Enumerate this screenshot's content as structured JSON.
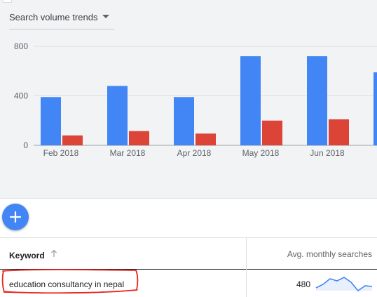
{
  "selector": {
    "label": "Search volume trends",
    "icon": "dropdown-caret-icon"
  },
  "chart_data": {
    "type": "bar",
    "categories": [
      "Feb 2018",
      "Mar 2018",
      "Apr 2018",
      "May 2018",
      "Jun 2018"
    ],
    "series": [
      {
        "values": [
          390,
          480,
          390,
          720,
          720
        ],
        "color": "#4285f4"
      },
      {
        "values": [
          80,
          115,
          95,
          200,
          210
        ],
        "color": "#db4437"
      }
    ],
    "y_ticks": [
      "0",
      "400",
      "800"
    ],
    "ylim": [
      0,
      800
    ],
    "grid": true,
    "legend": "none",
    "note_partial": "a sixth blue bar is cut off at the right edge (value ~590)"
  },
  "fab": {
    "icon": "plus-icon"
  },
  "table": {
    "columns": [
      {
        "label": "Keyword",
        "sort_icon": "arrow-up-icon"
      },
      {
        "label": "Avg. monthly searches"
      }
    ],
    "rows": [
      {
        "keyword": "education consultancy in nepal",
        "avg": "480",
        "trend": [
          0.2,
          0.45,
          0.85,
          0.7,
          0.95,
          0.6,
          0.0,
          0.35,
          0.3
        ]
      }
    ]
  },
  "colors": {
    "accent": "#4285f4",
    "secondary": "#db4437",
    "annotation": "#e8251f",
    "spark_fill": "#e8f0fe"
  }
}
